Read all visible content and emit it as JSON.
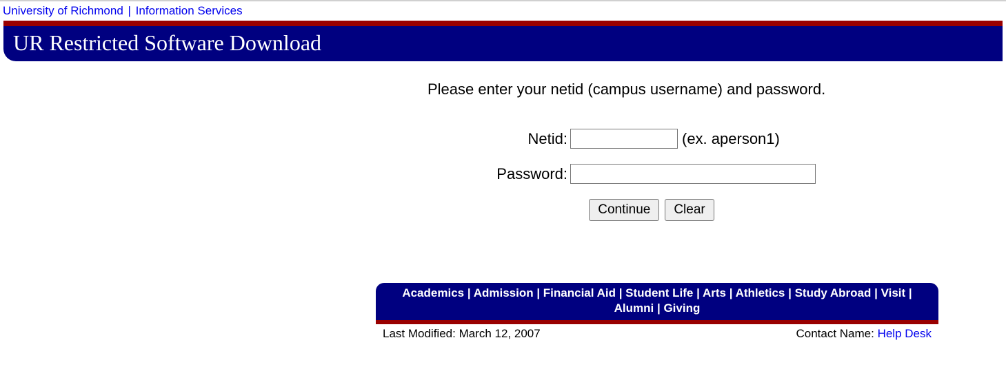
{
  "breadcrumb": {
    "link1": "University of Richmond",
    "sep": "|",
    "link2": "Information Services"
  },
  "header": {
    "title": "UR Restricted Software Download"
  },
  "main": {
    "instruction": "Please enter your netid (campus username) and password.",
    "netid_label": "Netid:",
    "netid_value": "",
    "netid_hint": "(ex. aperson1)",
    "password_label": "Password:",
    "password_value": "",
    "continue_label": "Continue",
    "clear_label": "Clear"
  },
  "footer": {
    "nav": {
      "academics": "Academics",
      "admission": "Admission",
      "financial_aid": "Financial Aid",
      "student_life": "Student Life",
      "arts": "Arts",
      "athletics": "Athletics",
      "study_abroad": "Study Abroad",
      "visit": "Visit",
      "alumni": "Alumni",
      "giving": "Giving",
      "sep": " | "
    },
    "last_modified_label": "Last Modified:  ",
    "last_modified_value": "March 12, 2007",
    "contact_label": "Contact Name:  ",
    "contact_link": "Help Desk"
  }
}
